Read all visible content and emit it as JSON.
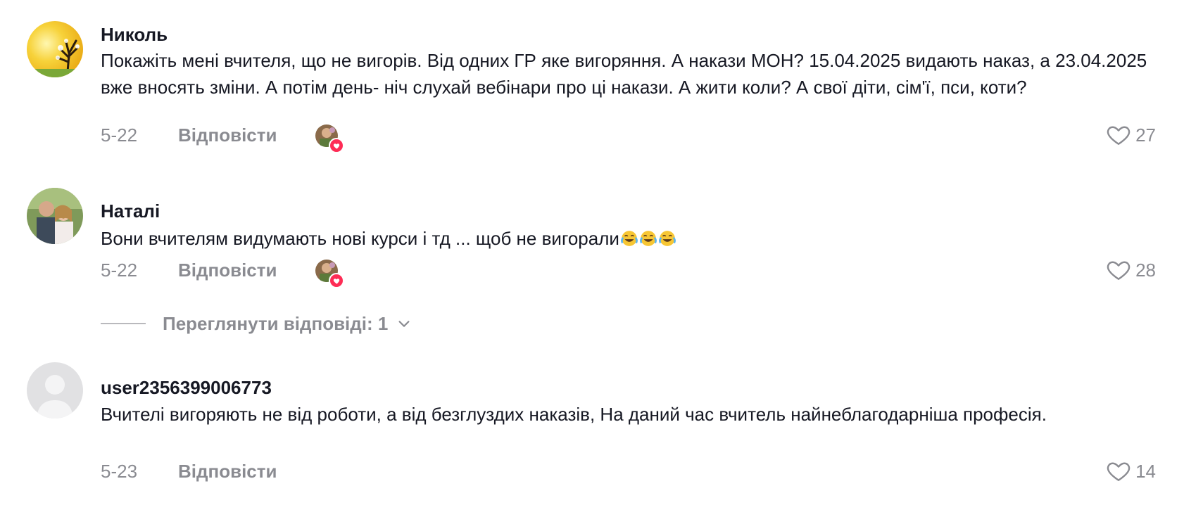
{
  "comments": [
    {
      "username": "Николь",
      "text": "Покажіть мені вчителя, що не вигорів. Від одних ГР яке вигоряння. А накази МОН? 15.04.2025 видають наказ, а 23.04.2025 вже вносять зміни. А потім день- ніч слухай вебінари про ці накази. А жити коли? А свої діти, сім'ї, пси, коти?",
      "date": "5-22",
      "reply_label": "Відповісти",
      "likes": "27",
      "liked_by_creator": true
    },
    {
      "username": "Наталі",
      "text": "Вони вчителям видумають нові курси і тд ... щоб не вигорали",
      "emoji_count": 3,
      "emoji_name": "face-with-tears-of-joy",
      "date": "5-22",
      "reply_label": "Відповісти",
      "likes": "28",
      "liked_by_creator": true,
      "view_replies_label": "Переглянути відповіді: 1"
    },
    {
      "username": "user2356399006773",
      "text": "Вчителі вигоряють не від роботи, а від безглуздих наказів, На даний час вчитель найнеблагодарніша професія.",
      "date": "5-23",
      "reply_label": "Відповісти",
      "likes": "14",
      "liked_by_creator": false
    }
  ],
  "colors": {
    "text_primary": "#161823",
    "text_secondary": "rgba(22,24,35,0.5)",
    "creator_like_badge": "#fe2c55"
  },
  "icons": {
    "like": "heart-outline-icon",
    "expand": "chevron-down-icon",
    "creator_badge": "heart-filled-icon"
  }
}
